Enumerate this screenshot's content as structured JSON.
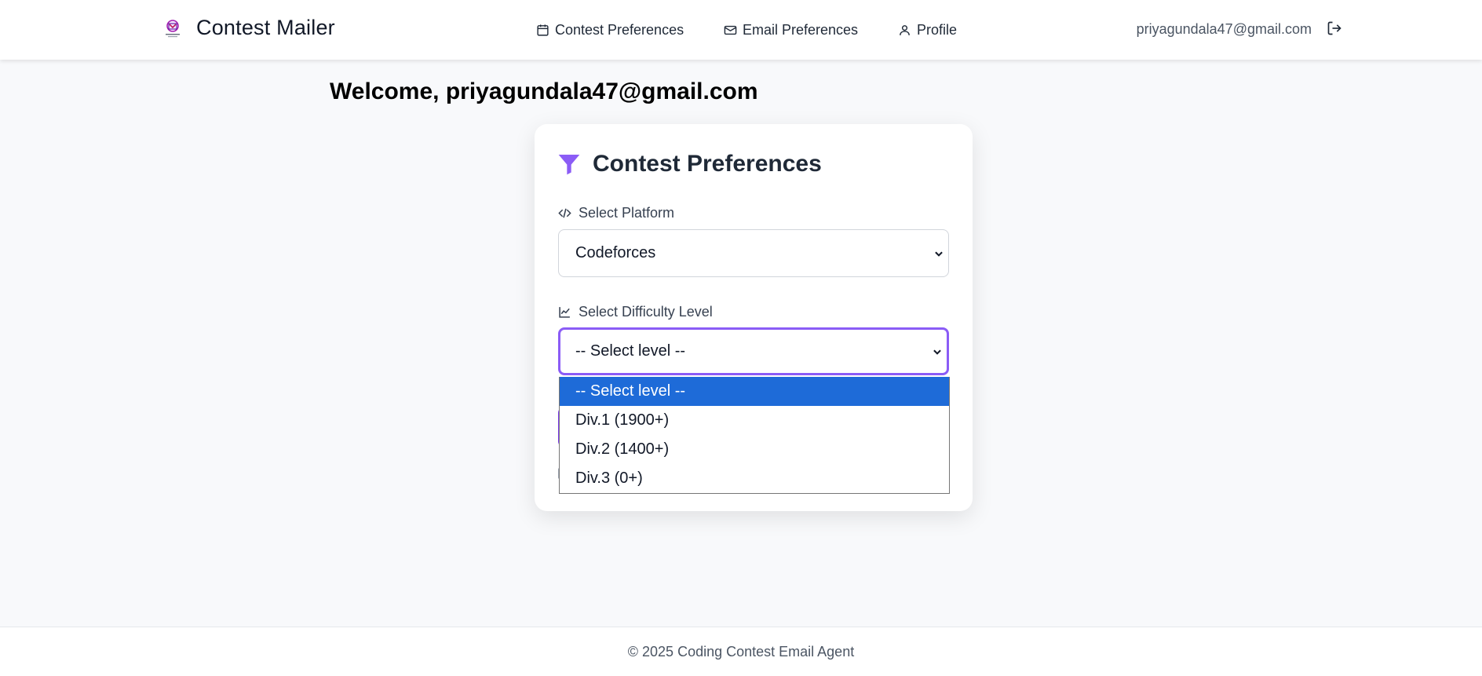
{
  "header": {
    "app_title": "Contest Mailer",
    "nav": [
      {
        "label": "Contest Preferences",
        "icon": "calendar-icon"
      },
      {
        "label": "Email Preferences",
        "icon": "mail-icon"
      },
      {
        "label": "Profile",
        "icon": "user-icon"
      }
    ],
    "user_email": "priyagundala47@gmail.com",
    "logout_icon": "logout-icon"
  },
  "welcome": "Welcome, priyagundala47@gmail.com",
  "card": {
    "title": "Contest Preferences",
    "title_icon": "filter-icon",
    "platform": {
      "label": "Select Platform",
      "icon": "code-icon",
      "value": "Codeforces"
    },
    "difficulty": {
      "label": "Select Difficulty Level",
      "icon": "chart-line-icon",
      "value": "-- Select level --",
      "options": [
        "-- Select level --",
        "Div.1 (1900+)",
        "Div.2 (1400+)",
        "Div.3 (0+)"
      ]
    }
  },
  "footer": {
    "text": "© 2025 Coding Contest Email Agent"
  },
  "colors": {
    "accent": "#8b5cf6",
    "selected_option": "#1e6bd8",
    "background": "#f8f9fb"
  }
}
